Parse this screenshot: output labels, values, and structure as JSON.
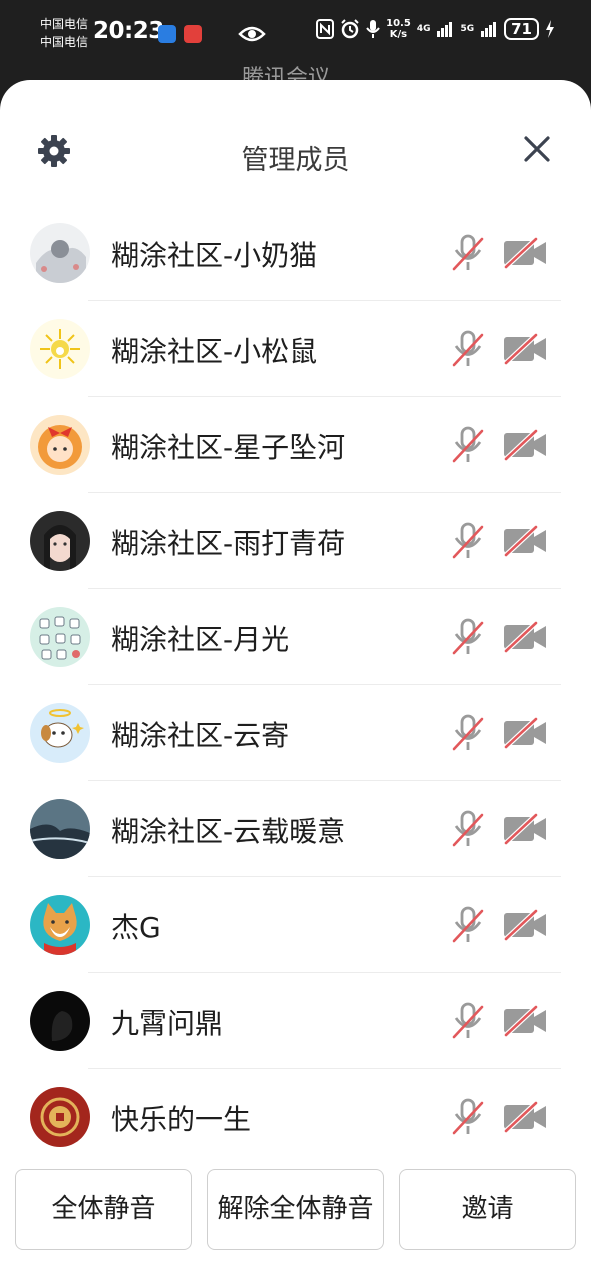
{
  "status_bar": {
    "carrier_1": "中国电信",
    "carrier_2": "中国电信",
    "time": "20:23",
    "net_speed_value": "10.5",
    "net_speed_unit": "K/s",
    "net_type_1": "4G",
    "net_type_2": "5G",
    "battery": "71"
  },
  "behind_title": "腾讯会议",
  "sheet": {
    "title": "管理成员"
  },
  "members": [
    {
      "name": "糊涂社区-小奶猫",
      "mic_muted": true,
      "camera_off": true
    },
    {
      "name": "糊涂社区-小松鼠",
      "mic_muted": true,
      "camera_off": true
    },
    {
      "name": "糊涂社区-星子坠河",
      "mic_muted": true,
      "camera_off": true
    },
    {
      "name": "糊涂社区-雨打青荷",
      "mic_muted": true,
      "camera_off": true
    },
    {
      "name": "糊涂社区-月光",
      "mic_muted": true,
      "camera_off": true
    },
    {
      "name": "糊涂社区-云寄",
      "mic_muted": true,
      "camera_off": true
    },
    {
      "name": "糊涂社区-云载暖意",
      "mic_muted": true,
      "camera_off": true
    },
    {
      "name": "杰G",
      "mic_muted": true,
      "camera_off": true
    },
    {
      "name": "九霄问鼎",
      "mic_muted": true,
      "camera_off": true
    },
    {
      "name": "快乐的一生",
      "mic_muted": true,
      "camera_off": true
    }
  ],
  "footer": {
    "mute_all": "全体静音",
    "unmute_all": "解除全体静音",
    "invite": "邀请"
  },
  "colors": {
    "muted_slash": "#e2585b",
    "icon_gray": "#9a9a9a"
  }
}
